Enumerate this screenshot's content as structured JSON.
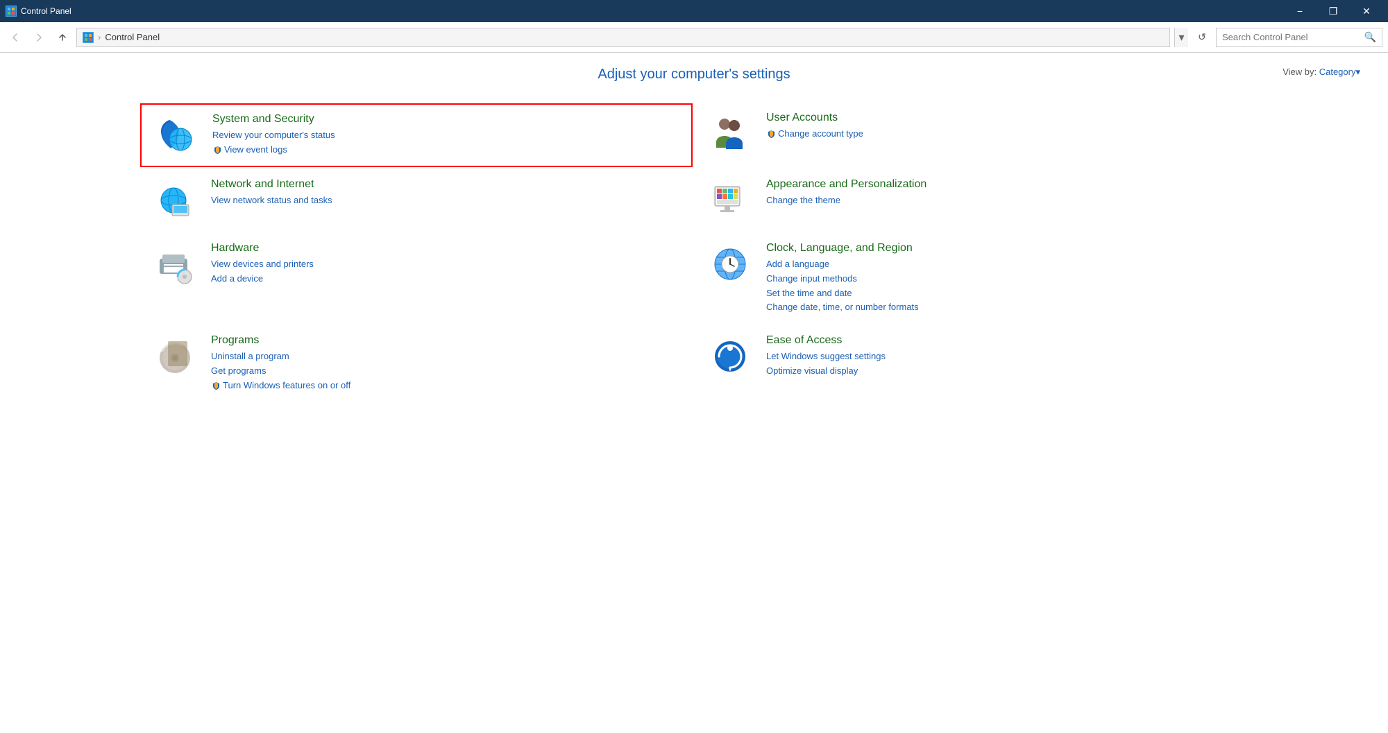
{
  "titlebar": {
    "title": "Control Panel",
    "minimize_label": "−",
    "restore_label": "❐",
    "close_label": "✕"
  },
  "addressbar": {
    "back_label": "‹",
    "forward_label": "›",
    "up_label": "↑",
    "path_label": "Control Panel",
    "dropdown_label": "▾",
    "refresh_label": "↺",
    "search_placeholder": "Search Control Panel"
  },
  "page": {
    "title": "Adjust your computer's settings",
    "viewby_label": "View by:",
    "viewby_value": "Category"
  },
  "categories": [
    {
      "id": "system-security",
      "title": "System and Security",
      "highlighted": true,
      "links": [
        {
          "text": "Review your computer's status",
          "shield": false
        },
        {
          "text": "View event logs",
          "shield": true
        }
      ]
    },
    {
      "id": "user-accounts",
      "title": "User Accounts",
      "highlighted": false,
      "links": [
        {
          "text": "Change account type",
          "shield": true
        }
      ]
    },
    {
      "id": "network-internet",
      "title": "Network and Internet",
      "highlighted": false,
      "links": [
        {
          "text": "View network status and tasks",
          "shield": false
        }
      ]
    },
    {
      "id": "appearance-personalization",
      "title": "Appearance and Personalization",
      "highlighted": false,
      "links": [
        {
          "text": "Change the theme",
          "shield": false
        }
      ]
    },
    {
      "id": "hardware",
      "title": "Hardware",
      "highlighted": false,
      "links": [
        {
          "text": "View devices and printers",
          "shield": false
        },
        {
          "text": "Add a device",
          "shield": false
        }
      ]
    },
    {
      "id": "clock-language-region",
      "title": "Clock, Language, and Region",
      "highlighted": false,
      "links": [
        {
          "text": "Add a language",
          "shield": false
        },
        {
          "text": "Change input methods",
          "shield": false
        },
        {
          "text": "Set the time and date",
          "shield": false
        },
        {
          "text": "Change date, time, or number formats",
          "shield": false
        }
      ]
    },
    {
      "id": "programs",
      "title": "Programs",
      "highlighted": false,
      "links": [
        {
          "text": "Uninstall a program",
          "shield": false
        },
        {
          "text": "Get programs",
          "shield": false
        },
        {
          "text": "Turn Windows features on or off",
          "shield": true
        }
      ]
    },
    {
      "id": "ease-of-access",
      "title": "Ease of Access",
      "highlighted": false,
      "links": [
        {
          "text": "Let Windows suggest settings",
          "shield": false
        },
        {
          "text": "Optimize visual display",
          "shield": false
        }
      ]
    }
  ]
}
